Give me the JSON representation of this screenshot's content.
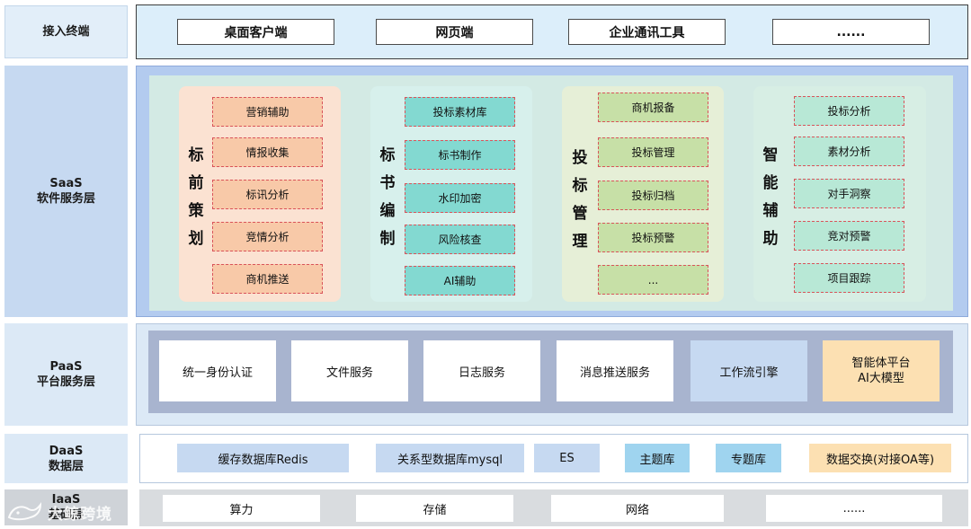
{
  "layers": {
    "terminal": {
      "label": "接入终端",
      "items": [
        "桌面客户端",
        "网页端",
        "企业通讯工具",
        "......"
      ]
    },
    "saas": {
      "label_line1": "SaaS",
      "label_line2": "软件服务层",
      "groups": [
        {
          "title": [
            "标",
            "前",
            "策",
            "划"
          ],
          "items": [
            "营销辅助",
            "情报收集",
            "标讯分析",
            "竞情分析",
            "商机推送"
          ]
        },
        {
          "title": [
            "标",
            "书",
            "编",
            "制"
          ],
          "items": [
            "投标素材库",
            "标书制作",
            "水印加密",
            "风险核查",
            "AI辅助"
          ]
        },
        {
          "title": [
            "投",
            "标",
            "管",
            "理"
          ],
          "items": [
            "商机报备",
            "投标管理",
            "投标归档",
            "投标预警",
            "..."
          ]
        },
        {
          "title": [
            "智",
            "能",
            "辅",
            "助"
          ],
          "items": [
            "投标分析",
            "素材分析",
            "对手洞察",
            "竞对预警",
            "项目跟踪"
          ]
        }
      ]
    },
    "paas": {
      "label_line1": "PaaS",
      "label_line2": "平台服务层",
      "items": [
        "统一身份认证",
        "文件服务",
        "日志服务",
        "消息推送服务",
        "工作流引擎"
      ],
      "ai_line1": "智能体平台",
      "ai_line2": "AI大模型"
    },
    "daas": {
      "label_line1": "DaaS",
      "label_line2": "数据层",
      "items": [
        "缓存数据库Redis",
        "关系型数据库mysql",
        "ES",
        "主题库",
        "专题库",
        "数据交换(对接OA等)"
      ]
    },
    "iaas": {
      "label_line1": "IaaS",
      "label_line2": "基础层",
      "items": [
        "算力",
        "存储",
        "网络",
        "......"
      ]
    }
  },
  "watermark": "大鲸跨境",
  "colors": {
    "saas_outer": "#b3cbef",
    "saas_inner": "#d3eae4",
    "group_orange": "#fbe2d2",
    "group_teal": "#d7f0ec",
    "group_green": "#e6efd7",
    "group_mint": "#d7eee4",
    "item_border": "#d9535a",
    "paas_inner": "#a8b4cf"
  }
}
